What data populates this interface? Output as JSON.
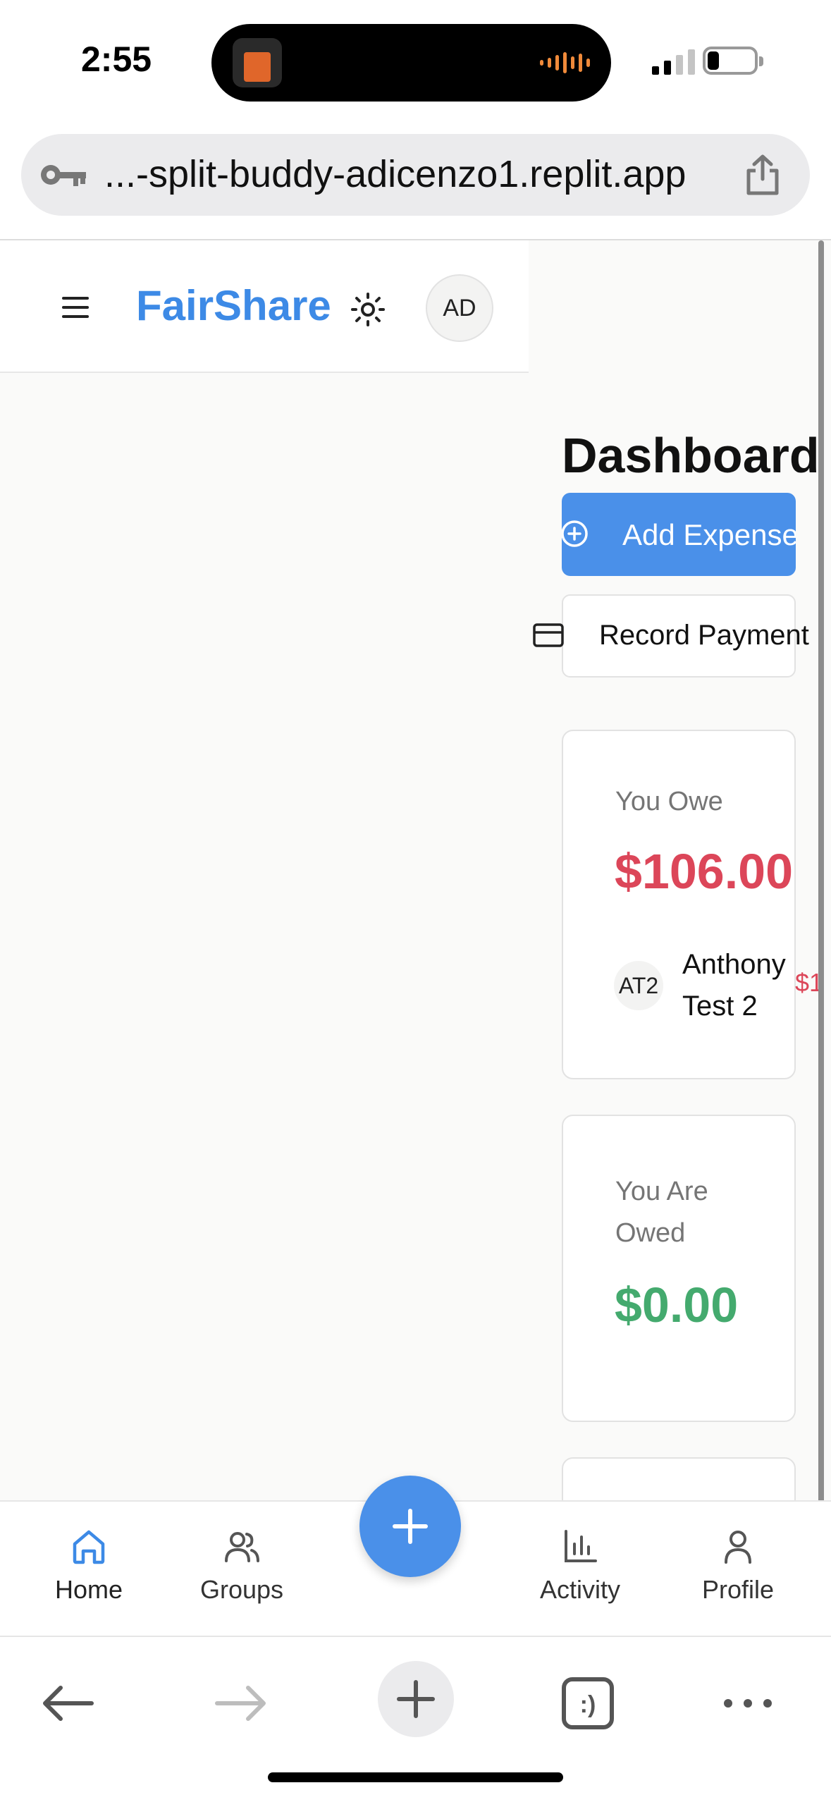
{
  "status_bar": {
    "time": "2:55"
  },
  "browser": {
    "url": "...-split-buddy-adicenzo1.replit.app",
    "tabs_glyph": ":)"
  },
  "header": {
    "brand": "FairShare",
    "avatar_initials": "AD",
    "icons": [
      "menu-icon",
      "sun-icon"
    ]
  },
  "dashboard": {
    "title": "Dashboard",
    "add_expense_label": "Add Expense",
    "record_payment_label": "Record Payment"
  },
  "you_owe": {
    "label": "You Owe",
    "amount": "$106.00",
    "people": [
      {
        "initials": "AT2",
        "name": "Anthony Test 2",
        "amount": "$1"
      }
    ]
  },
  "you_are_owed": {
    "label": "You Are Owed",
    "amount": "$0.00"
  },
  "bottom_nav": {
    "items": [
      {
        "label": "Home",
        "icon": "home-icon",
        "active": true
      },
      {
        "label": "Groups",
        "icon": "users-icon",
        "active": false
      },
      {
        "label": "Activity",
        "icon": "bar-chart-icon",
        "active": false
      },
      {
        "label": "Profile",
        "icon": "user-icon",
        "active": false
      }
    ]
  },
  "colors": {
    "brand": "#3d8ae6",
    "primary_button": "#4a90e9",
    "owe": "#dc4659",
    "owed": "#44aa6e"
  }
}
